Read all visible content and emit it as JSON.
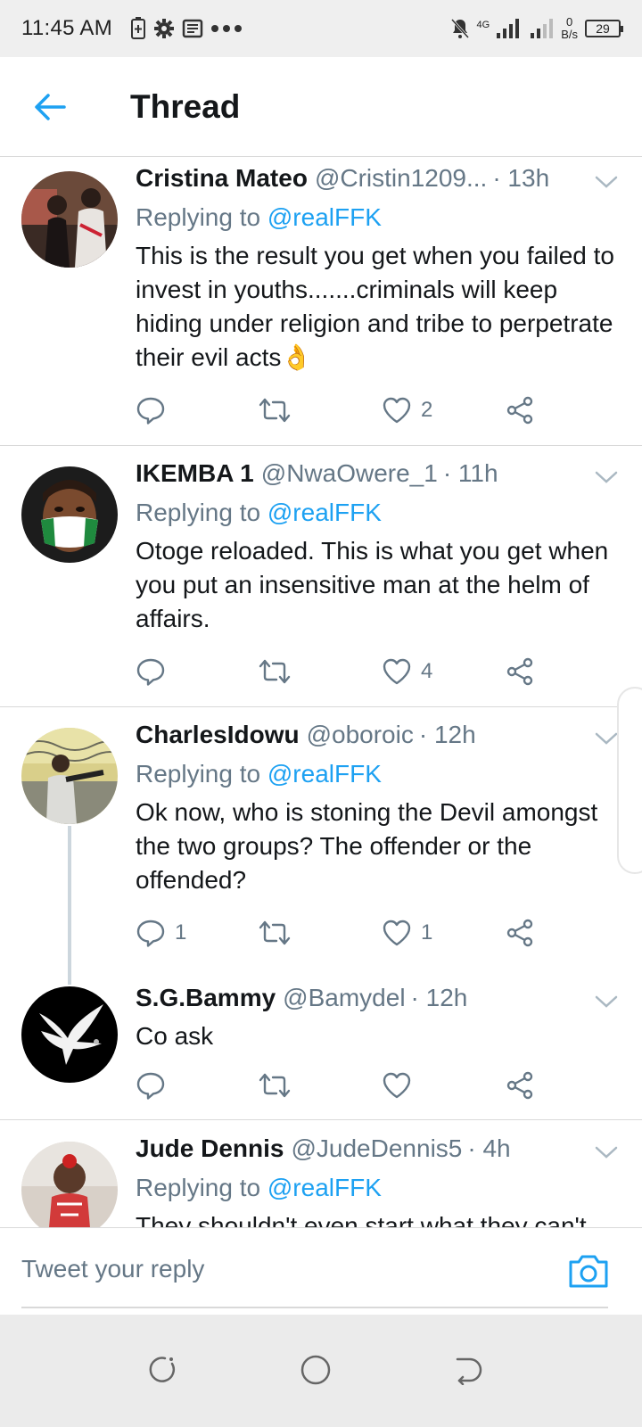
{
  "status_bar": {
    "time": "11:45 AM",
    "network_type": "4G",
    "speed_value": "0",
    "speed_unit": "B/s",
    "battery": "29"
  },
  "header": {
    "title": "Thread"
  },
  "tweets": [
    {
      "name": "Cristina Mateo",
      "handle": "@Cristin1209...",
      "time": "· 13h",
      "replying_prefix": "Replying to ",
      "replying_to": "@realFFK",
      "text": "This is the result you get when you failed to invest in youths.......criminals will keep hiding under religion and tribe to perpetrate their evil acts👌",
      "reply_count": "",
      "retweet_count": "",
      "like_count": "2"
    },
    {
      "name": "IKEMBA 1",
      "handle": "@NwaOwere_1",
      "time": "· 11h",
      "replying_prefix": "Replying to ",
      "replying_to": "@realFFK",
      "text": "Otoge reloaded. This is what you get when you put an insensitive man at the helm of affairs.",
      "reply_count": "",
      "retweet_count": "",
      "like_count": "4"
    },
    {
      "name": "CharlesIdowu",
      "handle": "@oboroic",
      "time": "· 12h",
      "replying_prefix": "Replying to ",
      "replying_to": "@realFFK",
      "text": "Ok now, who is stoning the Devil amongst the two groups? The offender or the offended?",
      "reply_count": "1",
      "retweet_count": "",
      "like_count": "1"
    },
    {
      "name": "S.G.Bammy",
      "handle": "@Bamydel",
      "time": "· 12h",
      "text": "Co ask",
      "reply_count": "",
      "retweet_count": "",
      "like_count": ""
    },
    {
      "name": "Jude Dennis",
      "handle": "@JudeDennis5",
      "time": "· 4h",
      "replying_prefix": "Replying to ",
      "replying_to": "@realFFK",
      "text": "They shouldn't even start what they can't"
    }
  ],
  "composer": {
    "placeholder": "Tweet your reply"
  },
  "colors": {
    "accent": "#1da1f2",
    "secondary_text": "#657786",
    "primary_text": "#14171a",
    "divider": "#d9d9d9"
  },
  "icons": {
    "back": "arrow-left-icon",
    "caret": "chevron-down-icon",
    "reply": "reply-bubble-icon",
    "retweet": "retweet-icon",
    "like": "heart-icon",
    "share": "share-icon",
    "camera": "camera-icon"
  }
}
